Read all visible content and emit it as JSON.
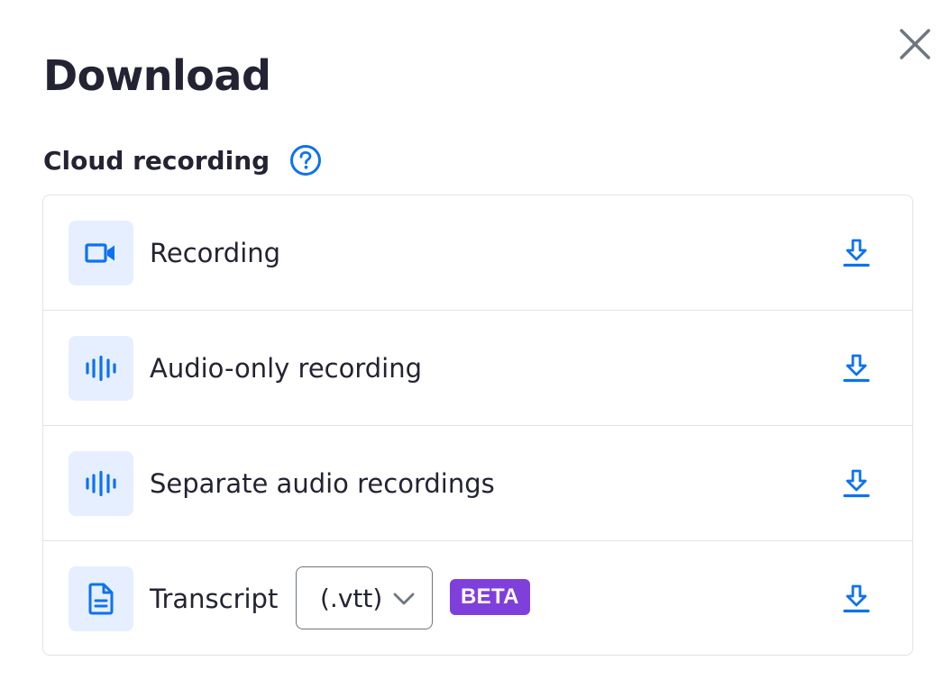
{
  "dialog": {
    "title": "Download",
    "close_icon": "close-icon"
  },
  "cloud_recording": {
    "label": "Cloud recording",
    "help_icon": "help-icon",
    "items": [
      {
        "label": "Recording",
        "icon": "video-camera-icon"
      },
      {
        "label": "Audio-only recording",
        "icon": "audio-waveform-icon"
      },
      {
        "label": "Separate audio recordings",
        "icon": "audio-waveform-icon"
      },
      {
        "label": "Transcript",
        "icon": "document-icon",
        "format_selected": "(.vtt)",
        "badge": "BETA"
      }
    ],
    "download_icon": "download-icon"
  },
  "colors": {
    "accent": "#0e72ed",
    "icon_bg": "#e6efff",
    "beta": "#7f3fdb",
    "text": "#232333",
    "border": "#dfe3e8"
  }
}
